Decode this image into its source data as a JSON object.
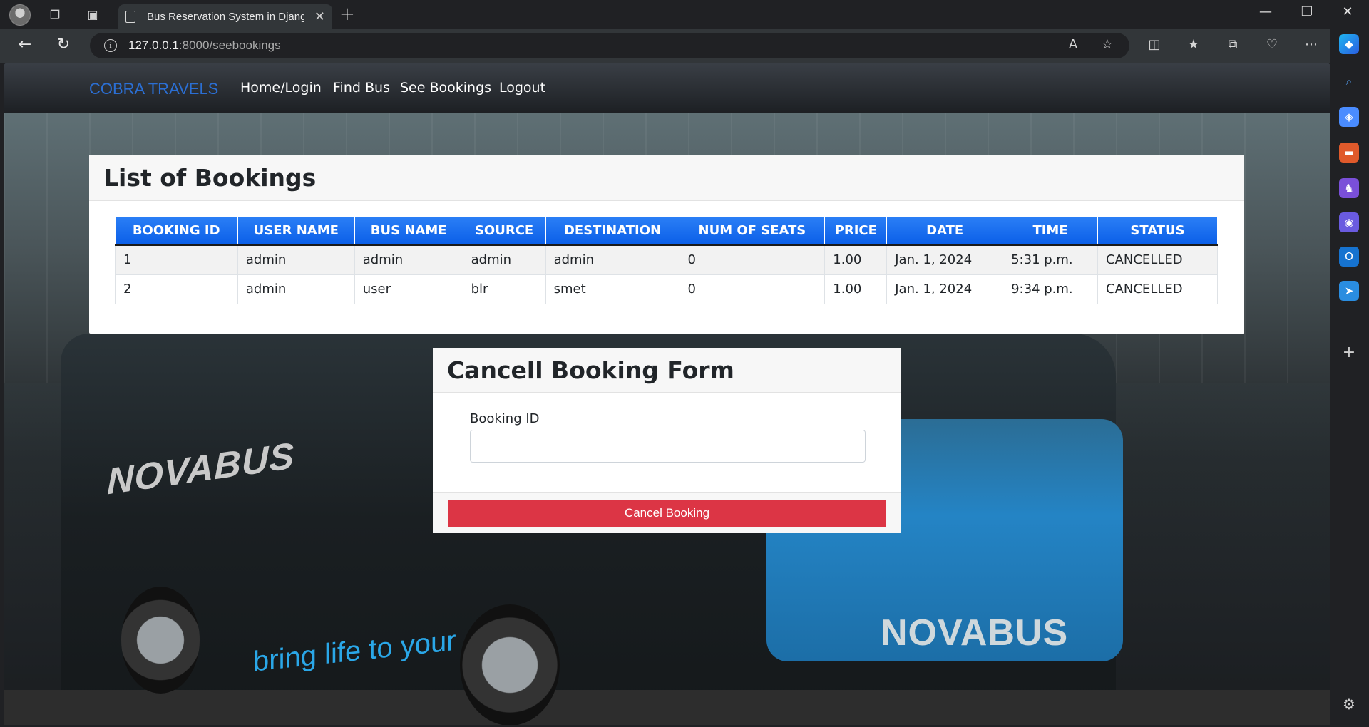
{
  "browser": {
    "tab_title": "Bus Reservation System in Djang",
    "url_host": "127.0.0.1",
    "url_path": ":8000/seebookings"
  },
  "navbar": {
    "brand": "COBRA TRAVELS",
    "links": [
      "Home/Login",
      "Find Bus",
      "See Bookings",
      "Logout"
    ]
  },
  "bookings": {
    "title": "List of Bookings",
    "columns": [
      "BOOKING ID",
      "USER NAME",
      "BUS NAME",
      "SOURCE",
      "DESTINATION",
      "NUM OF SEATS",
      "PRICE",
      "DATE",
      "TIME",
      "STATUS"
    ],
    "rows": [
      [
        "1",
        "admin",
        "admin",
        "admin",
        "admin",
        "0",
        "1.00",
        "Jan. 1, 2024",
        "5:31 p.m.",
        "CANCELLED"
      ],
      [
        "2",
        "admin",
        "user",
        "blr",
        "smet",
        "0",
        "1.00",
        "Jan. 1, 2024",
        "9:34 p.m.",
        "CANCELLED"
      ]
    ]
  },
  "cancel_form": {
    "title": "Cancell Booking Form",
    "field_label": "Booking ID",
    "field_value": "",
    "button_label": "Cancel Booking"
  },
  "background": {
    "side_logo": "NOVABUS",
    "front_logo": "NOVABUS",
    "slogan": "bring life to your city"
  },
  "colors": {
    "brand": "#2b6fd4",
    "table_header": "#0b5fe8",
    "danger": "#dc3545"
  }
}
